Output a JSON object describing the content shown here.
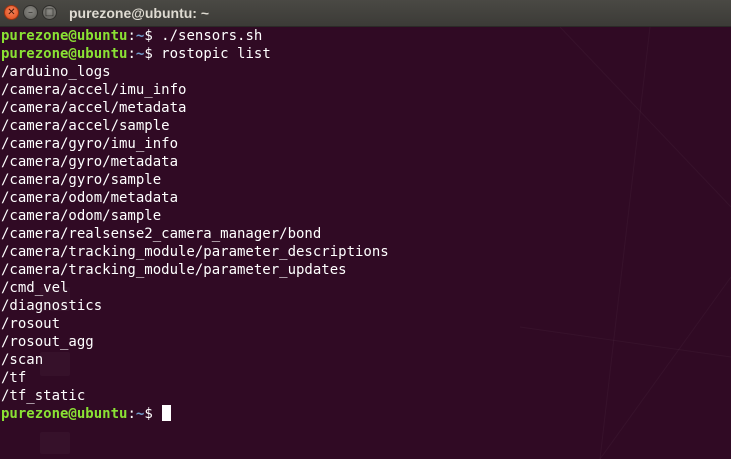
{
  "window": {
    "title": "purezone@ubuntu: ~",
    "close_glyph": "✕",
    "minimize_glyph": "–",
    "maximize_glyph": "□"
  },
  "prompt": {
    "user_host": "purezone@ubuntu",
    "separator": ":",
    "path": "~",
    "symbol": "$ "
  },
  "session": {
    "command_1": "./sensors.sh",
    "command_2": "rostopic list",
    "output": [
      "/arduino_logs",
      "/camera/accel/imu_info",
      "/camera/accel/metadata",
      "/camera/accel/sample",
      "/camera/gyro/imu_info",
      "/camera/gyro/metadata",
      "/camera/gyro/sample",
      "/camera/odom/metadata",
      "/camera/odom/sample",
      "/camera/realsense2_camera_manager/bond",
      "/camera/tracking_module/parameter_descriptions",
      "/camera/tracking_module/parameter_updates",
      "/cmd_vel",
      "/diagnostics",
      "/rosout",
      "/rosout_agg",
      "/scan",
      "/tf",
      "/tf_static"
    ]
  },
  "colors": {
    "background": "#300a24",
    "prompt_user": "#8ae234",
    "prompt_path": "#729fcf",
    "text": "#ffffff"
  }
}
